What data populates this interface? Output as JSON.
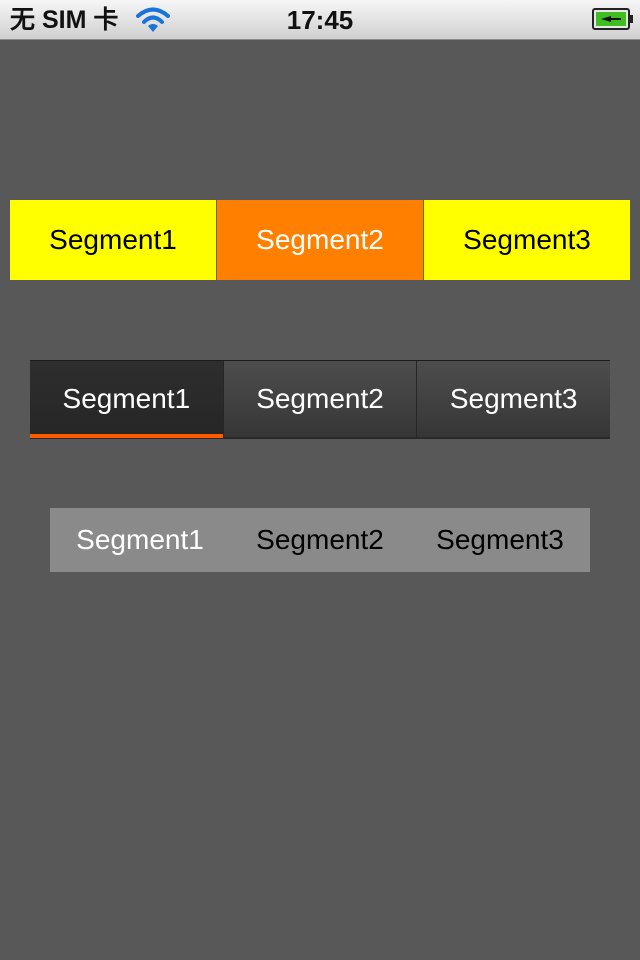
{
  "status_bar": {
    "carrier": "无 SIM 卡",
    "time": "17:45",
    "wifi_icon": "wifi-icon",
    "battery_icon": "battery-charging-icon"
  },
  "colored_segments": {
    "selected_color": "#ff8000",
    "normal_color": "#ffff00",
    "items": [
      {
        "label": "Segment1",
        "selected": false
      },
      {
        "label": "Segment2",
        "selected": true
      },
      {
        "label": "Segment3",
        "selected": false
      }
    ]
  },
  "dark_segments": {
    "indicator_color": "#ff5a00",
    "items": [
      {
        "label": "Segment1",
        "selected": true
      },
      {
        "label": "Segment2",
        "selected": false
      },
      {
        "label": "Segment3",
        "selected": false
      }
    ]
  },
  "plain_segments": {
    "background_color": "#8a8a8a",
    "items": [
      {
        "label": "Segment1",
        "selected": true
      },
      {
        "label": "Segment2",
        "selected": false
      },
      {
        "label": "Segment3",
        "selected": false
      }
    ]
  },
  "colors": {
    "background": "#585858"
  }
}
